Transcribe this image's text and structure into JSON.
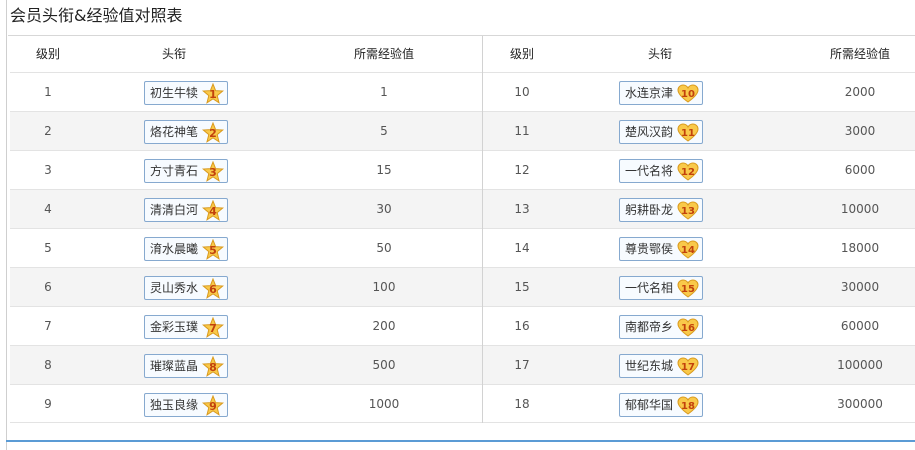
{
  "title": "会员头衔&经验值对照表",
  "headers": {
    "level": "级别",
    "title": "头衔",
    "exp": "所需经验值",
    "level2": "级别",
    "title2": "头衔",
    "exp2": "所需经验值"
  },
  "icon_names": [
    "star-badge-icon",
    "heart-badge-icon"
  ],
  "colors": {
    "badge_border": "#86a9cf",
    "badge_fill": "#f7fbff",
    "star_fill": "#f9c94a",
    "accent_rule": "#5b9bd5"
  },
  "rows": [
    {
      "left": {
        "level": "1",
        "title": "初生牛犊",
        "badge": "1",
        "exp": "1"
      },
      "right": {
        "level": "10",
        "title": "水连京津",
        "badge": "10",
        "exp": "2000"
      }
    },
    {
      "left": {
        "level": "2",
        "title": "烙花神笔",
        "badge": "2",
        "exp": "5"
      },
      "right": {
        "level": "11",
        "title": "楚风汉韵",
        "badge": "11",
        "exp": "3000"
      }
    },
    {
      "left": {
        "level": "3",
        "title": "方寸青石",
        "badge": "3",
        "exp": "15"
      },
      "right": {
        "level": "12",
        "title": "一代名将",
        "badge": "12",
        "exp": "6000"
      }
    },
    {
      "left": {
        "level": "4",
        "title": "清清白河",
        "badge": "4",
        "exp": "30"
      },
      "right": {
        "level": "13",
        "title": "躬耕卧龙",
        "badge": "13",
        "exp": "10000"
      }
    },
    {
      "left": {
        "level": "5",
        "title": "淯水晨曦",
        "badge": "5",
        "exp": "50"
      },
      "right": {
        "level": "14",
        "title": "尊贵鄂侯",
        "badge": "14",
        "exp": "18000"
      }
    },
    {
      "left": {
        "level": "6",
        "title": "灵山秀水",
        "badge": "6",
        "exp": "100"
      },
      "right": {
        "level": "15",
        "title": "一代名相",
        "badge": "15",
        "exp": "30000"
      }
    },
    {
      "left": {
        "level": "7",
        "title": "金彩玉璞",
        "badge": "7",
        "exp": "200"
      },
      "right": {
        "level": "16",
        "title": "南都帝乡",
        "badge": "16",
        "exp": "60000"
      }
    },
    {
      "left": {
        "level": "8",
        "title": "璀璨蓝晶",
        "badge": "8",
        "exp": "500"
      },
      "right": {
        "level": "17",
        "title": "世纪东城",
        "badge": "17",
        "exp": "100000"
      }
    },
    {
      "left": {
        "level": "9",
        "title": "独玉良缘",
        "badge": "9",
        "exp": "1000"
      },
      "right": {
        "level": "18",
        "title": "郁郁华国",
        "badge": "18",
        "exp": "300000"
      }
    }
  ]
}
